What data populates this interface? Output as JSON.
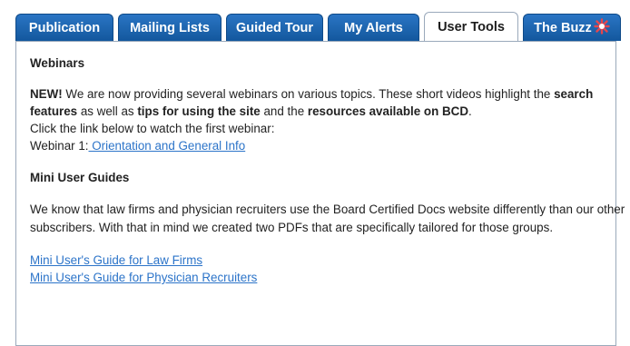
{
  "tabs": [
    {
      "label": "Publication",
      "active": false
    },
    {
      "label": "Mailing Lists",
      "active": false
    },
    {
      "label": "Guided Tour",
      "active": false
    },
    {
      "label": "My Alerts",
      "active": false
    },
    {
      "label": "User Tools",
      "active": true
    },
    {
      "label": "The Buzz",
      "active": false
    }
  ],
  "webinars": {
    "heading": "Webinars",
    "new_label": "NEW!",
    "text1": " We are now providing several webinars on various topics. These short videos highlight the ",
    "bold1": "search features",
    "text2": " as well as ",
    "bold2": "tips for using the site",
    "text3": " and the ",
    "bold3": "resources available on BCD",
    "text4": ".",
    "line2": "Click the link below to watch the first webinar:",
    "webinar_prefix": "Webinar 1:",
    "webinar_link": " Orientation and General Info"
  },
  "guides": {
    "heading": "Mini User Guides",
    "body": "We know that law firms and physician recruiters use the Board Certified Docs website differently than our other subscribers. With that in mind we created two PDFs that are specifically tailored for those groups.",
    "link1": "Mini User's Guide for Law Firms",
    "link2": "Mini User's Guide for Physician Recruiters"
  },
  "colors": {
    "tab_blue": "#1b5fa6",
    "link_blue": "#2c74c9",
    "buzz_icon": "#e8474c"
  },
  "icons": {
    "buzz": "buzz-starburst-icon"
  }
}
